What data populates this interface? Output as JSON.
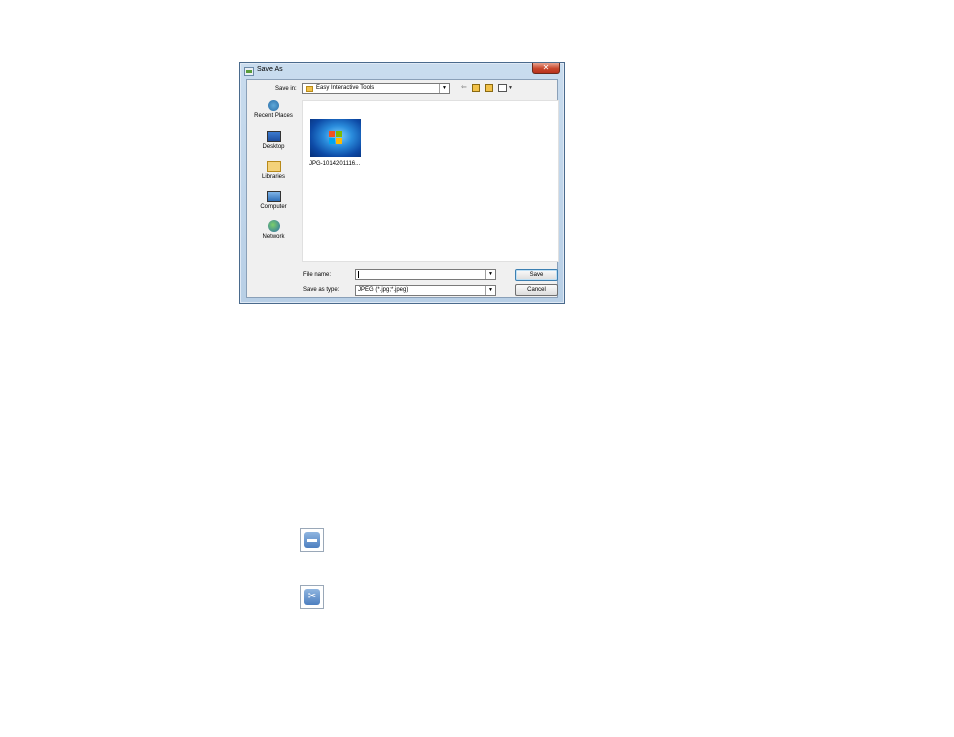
{
  "dialog": {
    "title": "Save As",
    "close_glyph": "✕",
    "save_in_label": "Save in:",
    "save_in_value": "Easy Interactive Tools",
    "toolbar_icons": [
      "back-icon",
      "up-folder-icon",
      "new-folder-icon",
      "view-menu-icon"
    ],
    "places": [
      {
        "label": "Recent Places",
        "icon": "recent-places-icon"
      },
      {
        "label": "Desktop",
        "icon": "desktop-icon"
      },
      {
        "label": "Libraries",
        "icon": "libraries-icon"
      },
      {
        "label": "Computer",
        "icon": "computer-icon"
      },
      {
        "label": "Network",
        "icon": "network-icon"
      }
    ],
    "files": [
      {
        "name": "JPG-1014201116..."
      }
    ],
    "file_name_label": "File name:",
    "file_name_value": "",
    "save_as_type_label": "Save as type:",
    "save_as_type_value": "JPEG (*.jpg;*.jpeg)",
    "save_button": "Save",
    "cancel_button": "Cancel"
  },
  "page_icons": [
    "toolbox-icon",
    "tools-icon"
  ]
}
